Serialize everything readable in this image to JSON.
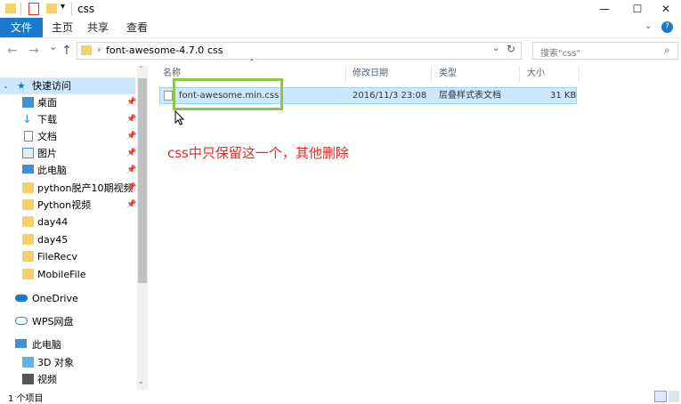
{
  "window": {
    "title": "css",
    "minimize": "—",
    "maximize": "☐",
    "close": "✕"
  },
  "ribbon": {
    "tabs": [
      {
        "label": "文件"
      },
      {
        "label": "主页"
      },
      {
        "label": "共享"
      },
      {
        "label": "查看"
      }
    ]
  },
  "address": {
    "back": "←",
    "forward": "→",
    "recent": "⌄",
    "up": "↑",
    "crumbs": [
      "font-awesome-4.7.0",
      "css"
    ],
    "separator": "›"
  },
  "search": {
    "placeholder": "搜索\"css\""
  },
  "sidebar": {
    "quick_access": "快速访问",
    "items": [
      {
        "label": "桌面",
        "icon": "desktop-icon",
        "pinned": true
      },
      {
        "label": "下载",
        "icon": "download-icon",
        "pinned": true
      },
      {
        "label": "文档",
        "icon": "document-icon",
        "pinned": true
      },
      {
        "label": "图片",
        "icon": "picture-icon",
        "pinned": true
      },
      {
        "label": "此电脑",
        "icon": "computer-icon",
        "pinned": true
      },
      {
        "label": "python脱产10期视频",
        "icon": "folder-icon",
        "pinned": true
      },
      {
        "label": "Python视频",
        "icon": "folder-icon",
        "pinned": true
      },
      {
        "label": "day44",
        "icon": "folder-icon",
        "pinned": false
      },
      {
        "label": "day45",
        "icon": "folder-icon",
        "pinned": false
      },
      {
        "label": "FileRecv",
        "icon": "folder-icon",
        "pinned": false
      },
      {
        "label": "MobileFile",
        "icon": "folder-icon",
        "pinned": false
      }
    ],
    "onedrive": "OneDrive",
    "wps": "WPS网盘",
    "this_pc": "此电脑",
    "pc_items": [
      {
        "label": "3D 对象",
        "icon": "3d-objects-icon"
      },
      {
        "label": "视频",
        "icon": "video-icon"
      }
    ]
  },
  "columns": {
    "name": "名称",
    "modified": "修改日期",
    "type": "类型",
    "size": "大小"
  },
  "files": [
    {
      "name": "font-awesome.min.css",
      "modified": "2016/11/3 23:08",
      "type": "层叠样式表文档",
      "size": "31 KB"
    }
  ],
  "annotation": "css中只保留这一个，其他删除",
  "status": {
    "count": "1 个项目"
  },
  "colors": {
    "accent": "#1979ca",
    "selection": "#cce8ff",
    "highlight": "#8dc63f",
    "annotation": "#e8281f"
  }
}
